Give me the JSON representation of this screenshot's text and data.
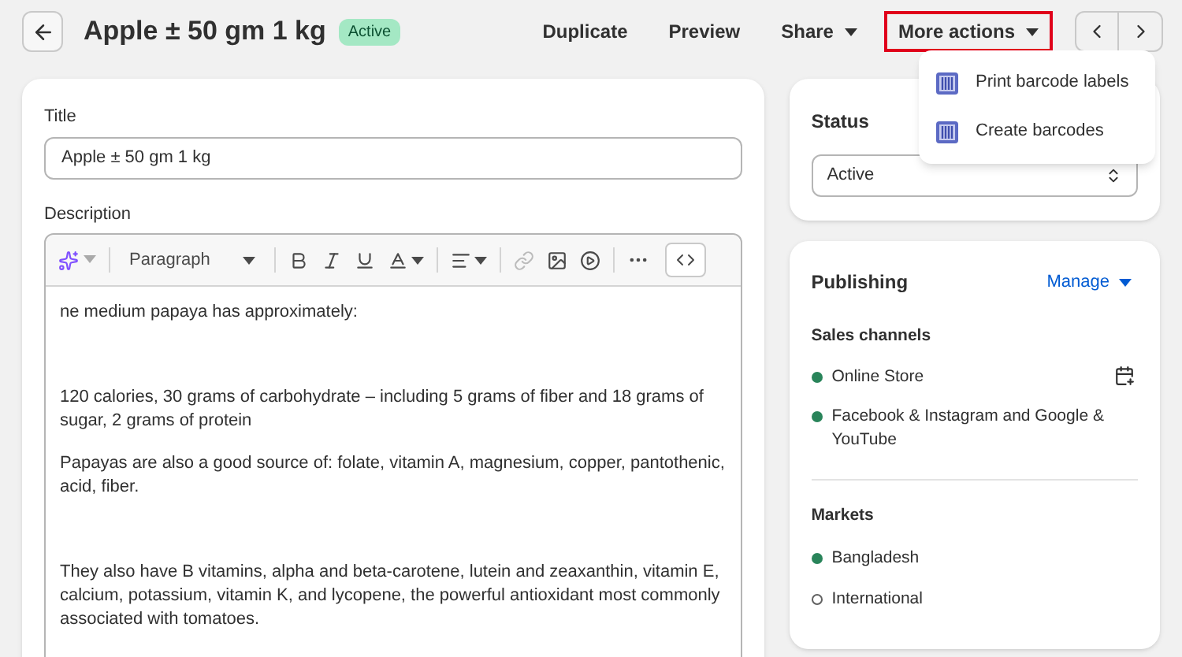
{
  "header": {
    "title": "Apple ± 50 gm 1 kg",
    "badge": "Active",
    "actions": [
      {
        "label": "Duplicate",
        "kind": "plain",
        "highlighted": false
      },
      {
        "label": "Preview",
        "kind": "plain",
        "highlighted": false
      },
      {
        "label": "Share",
        "kind": "menu",
        "highlighted": false
      },
      {
        "label": "More actions",
        "kind": "menu",
        "highlighted": true
      }
    ]
  },
  "menu": {
    "open": true,
    "items": [
      "Print barcode labels",
      "Create barcodes"
    ]
  },
  "title_field": {
    "label": "Title",
    "value": "Apple ± 50 gm 1 kg"
  },
  "description": {
    "label": "Description",
    "format": "Paragraph",
    "paragraphs": [
      {
        "text": "ne medium papaya has approximately:",
        "kind": "normal"
      },
      {
        "text": "120 calories, 30 grams of carbohydrate – including 5 grams of fiber and 18 grams of sugar, 2 grams of protein",
        "kind": "after-blank"
      },
      {
        "text": "Papayas are also a good source of: folate, vitamin A, magnesium, copper, pantothenic, acid, fiber.",
        "kind": "normal"
      },
      {
        "text": "They also have B vitamins, alpha and beta-carotene, lutein and zeaxanthin, vitamin E, calcium, potassium, vitamin K, and lycopene, the powerful antioxidant most commonly associated with tomatoes.",
        "kind": "after-blank"
      }
    ]
  },
  "status": {
    "heading": "Status",
    "value": "Active"
  },
  "publishing": {
    "heading": "Publishing",
    "manage": "Manage",
    "channels_heading": "Sales channels",
    "channels": [
      {
        "name": "Online Store",
        "published": true,
        "schedule": true
      },
      {
        "name": "Facebook & Instagram and Google & YouTube",
        "published": true,
        "schedule": false
      }
    ],
    "markets_heading": "Markets",
    "markets": [
      {
        "name": "Bangladesh",
        "published": true
      },
      {
        "name": "International",
        "published": false
      }
    ]
  }
}
